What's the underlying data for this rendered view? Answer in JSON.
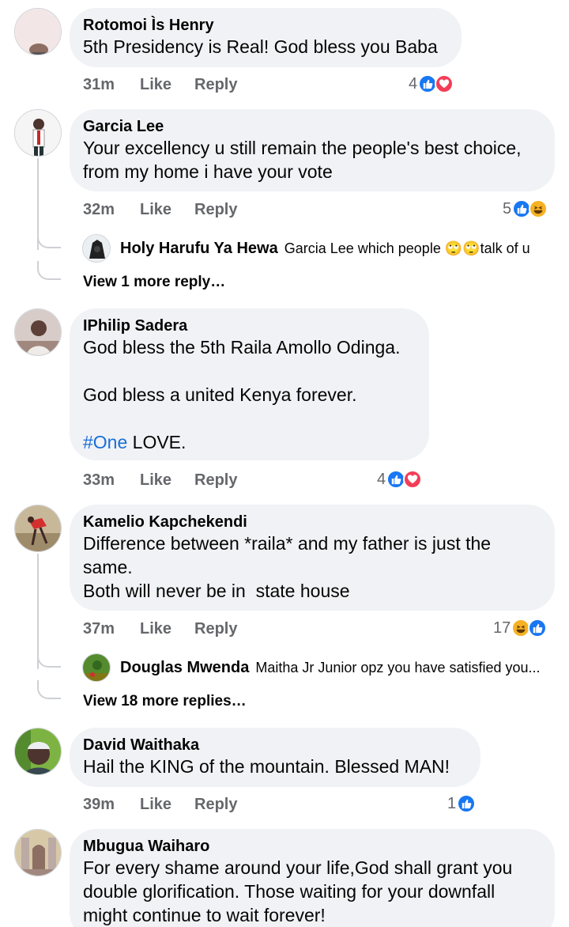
{
  "comments": [
    {
      "name": "Rotomoi Ìs Henry",
      "text": "5th Presidency is Real! God bless you Baba",
      "time": "31m",
      "like_label": "Like",
      "reply_label": "Reply",
      "reaction_count": "4",
      "reactions": [
        "like-icon",
        "love-icon"
      ]
    },
    {
      "name": "Garcia Lee",
      "text": "Your excellency u still remain the people's best choice,\nfrom my home i have your vote",
      "time": "32m",
      "like_label": "Like",
      "reply_label": "Reply",
      "reaction_count": "5",
      "reactions": [
        "like-icon",
        "haha-icon"
      ],
      "reply_preview": {
        "name": "Holy Harufu Ya Hewa",
        "text": "Garcia Lee which people 🙄🙄talk of u"
      },
      "view_more": "View 1 more reply…"
    },
    {
      "name": "IPhilip Sadera",
      "text_lines": [
        "God bless the 5th Raila Amollo Odinga.",
        "",
        "God bless a united Kenya forever.",
        ""
      ],
      "hashtag": "#One",
      "hashtag_tail": " LOVE.",
      "time": "33m",
      "like_label": "Like",
      "reply_label": "Reply",
      "reaction_count": "4",
      "reactions": [
        "like-icon",
        "love-icon"
      ]
    },
    {
      "name": "Kamelio Kapchekendi",
      "text": "Difference between *raila* and my father is just the\nsame.\nBoth will never be in  state house",
      "time": "37m",
      "like_label": "Like",
      "reply_label": "Reply",
      "reaction_count": "17",
      "reactions": [
        "haha-icon",
        "like-icon"
      ],
      "reply_preview": {
        "name": "Douglas Mwenda",
        "text": "Maitha Jr Junior opz you have satisfied you..."
      },
      "view_more": "View 18 more replies…"
    },
    {
      "name": "David Waithaka",
      "text": "Hail the KING of the mountain. Blessed MAN!",
      "time": "39m",
      "like_label": "Like",
      "reply_label": "Reply",
      "reaction_count": "1",
      "reactions": [
        "like-icon"
      ]
    },
    {
      "name": "Mbugua Waiharo",
      "text": "For every shame around your life,God shall grant you\ndouble glorification. Those waiting for your downfall\nmight continue to wait forever!"
    }
  ],
  "colors": {
    "bubble": "#f0f2f5",
    "meta_text": "#65676b",
    "like": "#1877f2",
    "love": "#f33e58",
    "haha": "#f7b125",
    "hashtag": "#1a6ed8"
  }
}
